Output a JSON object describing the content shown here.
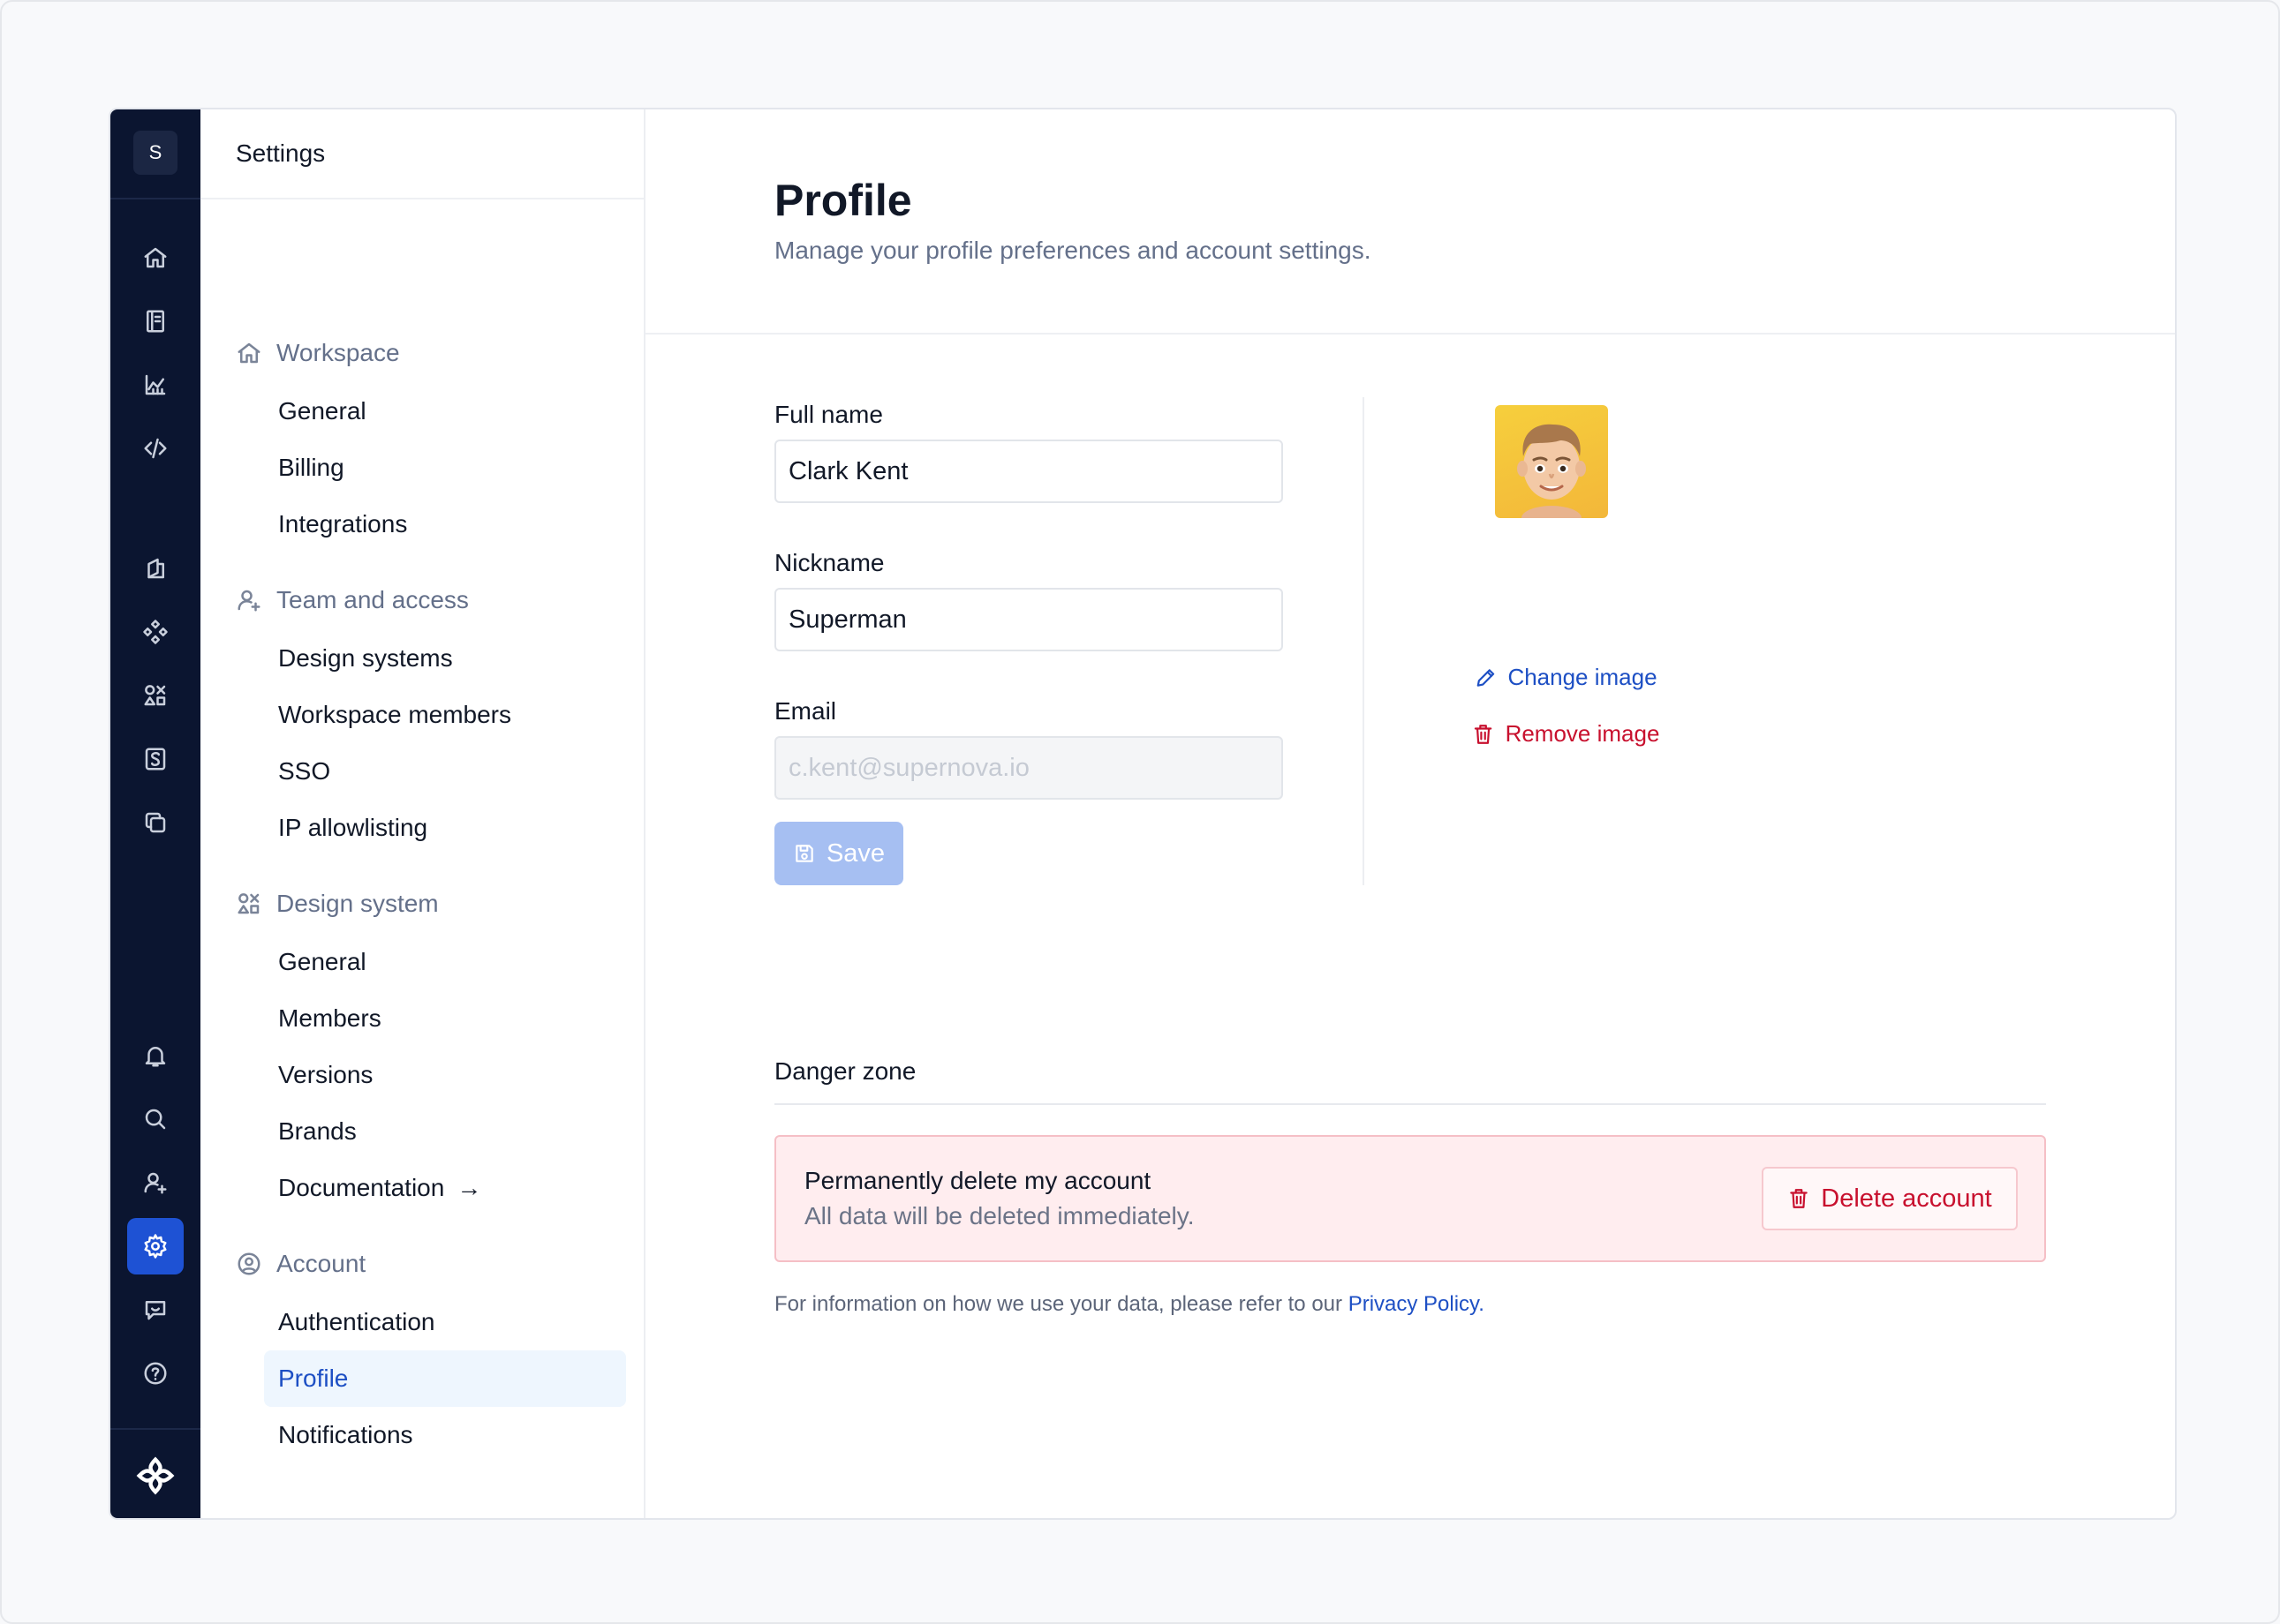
{
  "rail": {
    "logo_letter": "S",
    "icons": [
      "home-icon",
      "book-icon",
      "chart-icon",
      "code-icon",
      "pages-icon",
      "components-icon",
      "shapes-icon",
      "storybook-icon",
      "copy-icon",
      "bell-icon",
      "search-icon",
      "add-user-icon",
      "gear-icon",
      "chat-icon",
      "help-icon",
      "brand-logo-icon"
    ],
    "active_icon": "gear-icon"
  },
  "nav": {
    "title": "Settings",
    "sections": [
      {
        "label": "Workspace",
        "icon": "home-icon",
        "items": [
          "General",
          "Billing",
          "Integrations"
        ]
      },
      {
        "label": "Team and access",
        "icon": "add-user-icon",
        "items": [
          "Design systems",
          "Workspace members",
          "SSO",
          "IP allowlisting"
        ]
      },
      {
        "label": "Design system",
        "icon": "shapes-icon",
        "items": [
          "General",
          "Members",
          "Versions",
          "Brands",
          "Documentation"
        ]
      },
      {
        "label": "Account",
        "icon": "user-circle-icon",
        "items": [
          "Authentication",
          "Profile",
          "Notifications"
        ]
      }
    ],
    "active_item": "Profile"
  },
  "page": {
    "title": "Profile",
    "subtitle": "Manage your profile preferences and account settings."
  },
  "form": {
    "full_name_label": "Full name",
    "full_name_value": "Clark Kent",
    "nickname_label": "Nickname",
    "nickname_value": "Superman",
    "email_label": "Email",
    "email_placeholder": "c.kent@supernova.io",
    "save_label": "Save"
  },
  "avatar": {
    "change_label": "Change image",
    "remove_label": "Remove image"
  },
  "danger": {
    "title": "Danger zone",
    "heading": "Permanently delete my account",
    "description": "All data will be deleted immediately.",
    "delete_label": "Delete account"
  },
  "footer": {
    "note": "For information on how we use your data, please refer to our",
    "link": "Privacy Policy."
  },
  "colors": {
    "rail_bg": "#0b1530",
    "accent": "#1e52d4",
    "danger": "#c8102e",
    "danger_bg": "#ffedef"
  }
}
